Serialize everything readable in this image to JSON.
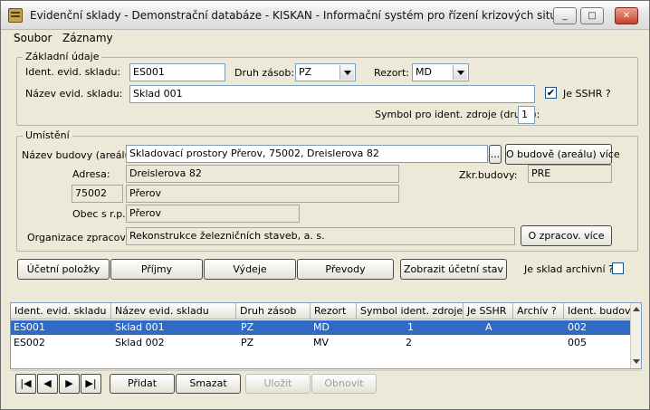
{
  "window": {
    "title": "Evidenční sklady - Demonstrační databáze - KISKAN - Informační systém pro řízení krizových situací",
    "min": "_",
    "max": "□",
    "close": "✕"
  },
  "menu": {
    "items": [
      "Soubor",
      "Záznamy"
    ]
  },
  "basic": {
    "legend": "Základní údaje",
    "ident_label": "Ident. evid. skladu:",
    "ident_value": "ES001",
    "druh_label": "Druh zásob:",
    "druh_value": "PZ",
    "rezort_label": "Rezort:",
    "rezort_value": "MD",
    "nazev_label": "Název evid. skladu:",
    "nazev_value": "Sklad 001",
    "ssnr_label": "Je SSHR ?",
    "ssnr_checked": "✔",
    "symbol_label": "Symbol pro ident. zdroje (druhý):",
    "symbol_value": "1"
  },
  "location": {
    "legend": "Umístění",
    "budova_label": "Název budovy (areálu):",
    "budova_value": "Skladovací prostory Přerov, 75002, Dreislerova 82",
    "budova_browse": "...",
    "budova_more": "O budově (areálu) více",
    "adresa_label": "Adresa:",
    "adresa_value": "Dreislerova 82",
    "zkr_label": "Zkr.budovy:",
    "zkr_value": "PRE",
    "psc_value": "75002",
    "mesto_value": "Přerov",
    "obec_label": "Obec s r.p.:",
    "obec_value": "Přerov",
    "org_label": "Organizace zpracov.:",
    "org_value": "Rekonstrukce železničních staveb, a. s.",
    "org_more": "O zpracov. více"
  },
  "actions": {
    "ucetni": "Účetní položky",
    "prijmy": "Příjmy",
    "vydeje": "Výdeje",
    "prevody": "Převody",
    "zobrazit": "Zobrazit účetní stav",
    "archiv_label": "Je sklad archivní ?"
  },
  "table": {
    "columns": [
      "Ident. evid. skladu",
      "Název evid. skladu",
      "Druh zásob",
      "Rezort",
      "Symbol ident. zdroje",
      "Je SSHR",
      "Archív ?",
      "Ident. budovy"
    ],
    "rows": [
      [
        "ES001",
        "Sklad 001",
        "PZ",
        "MD",
        "1",
        "A",
        "",
        "002"
      ],
      [
        "ES002",
        "Sklad 002",
        "PZ",
        "MV",
        "2",
        "",
        "",
        "005"
      ]
    ]
  },
  "nav": {
    "first": "|◀",
    "prev": "◀",
    "next": "▶",
    "last": "▶|",
    "pridat": "Přidat",
    "smazat": "Smazat",
    "ulozit": "Uložit",
    "obnovit": "Obnovit"
  }
}
